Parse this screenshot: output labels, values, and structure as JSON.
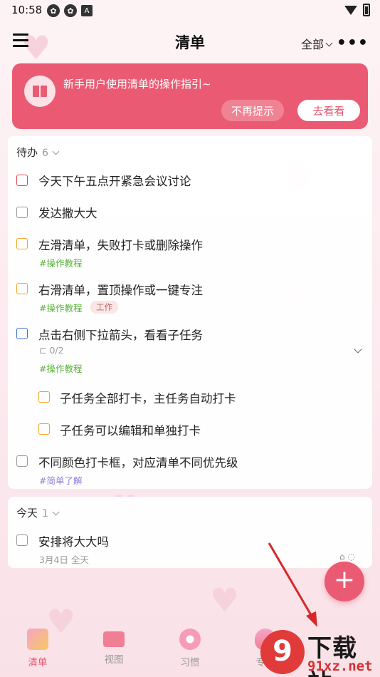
{
  "status_bar": {
    "time": "10:58",
    "notif_icons": [
      "✿",
      "✿",
      "A"
    ]
  },
  "header": {
    "title": "清单",
    "filter_label": "全部",
    "more_icon": "•••"
  },
  "banner": {
    "text": "新手用户使用清单的操作指引~",
    "dismiss_label": "不再提示",
    "go_label": "去看看"
  },
  "todo_section": {
    "title": "待办",
    "count": "6",
    "items": [
      {
        "title": "今天下午五点开紧急会议讨论",
        "priority": "red"
      },
      {
        "title": "发达撒大大",
        "priority": "gray"
      },
      {
        "title": "左滑清单，失败打卡或删除操作",
        "priority": "orange",
        "tag": "#操作教程"
      },
      {
        "title": "右滑清单，置顶操作或一键专注",
        "priority": "orange",
        "tag": "#操作教程",
        "chip": "工作"
      },
      {
        "title": "点击右侧下拉箭头，看看子任务",
        "priority": "blue",
        "subtask_progress": "0/2",
        "tag": "#操作教程"
      },
      {
        "title": "子任务全部打卡，主任务自动打卡",
        "priority": "orange",
        "subtask": true
      },
      {
        "title": "子任务可以编辑和单独打卡",
        "priority": "orange",
        "subtask": true
      },
      {
        "title": "不同颜色打卡框，对应清单不同优先级",
        "priority": "gray",
        "tag": "#简单了解"
      }
    ]
  },
  "today_section": {
    "title": "今天",
    "count": "1",
    "items": [
      {
        "title": "安排将大大吗",
        "meta": "3月4日 全天"
      }
    ]
  },
  "fab_label": "+",
  "bottom_nav": [
    {
      "label": "清单",
      "active": true,
      "icon": "list-gift-icon"
    },
    {
      "label": "视图",
      "active": false,
      "icon": "envelope-icon"
    },
    {
      "label": "习惯",
      "active": false,
      "icon": "donut-icon"
    },
    {
      "label": "专注",
      "active": false,
      "icon": "balloon-icon"
    }
  ],
  "watermark": {
    "logo": "9",
    "line1": "下载站",
    "line2": "91xz.net"
  },
  "colors": {
    "accent": "#ea5b73",
    "priority_red": "#e54753",
    "priority_orange": "#f5a524",
    "priority_blue": "#3b6fd6",
    "tag_green": "#58b33b",
    "tag_purple": "#8b7ee0"
  }
}
